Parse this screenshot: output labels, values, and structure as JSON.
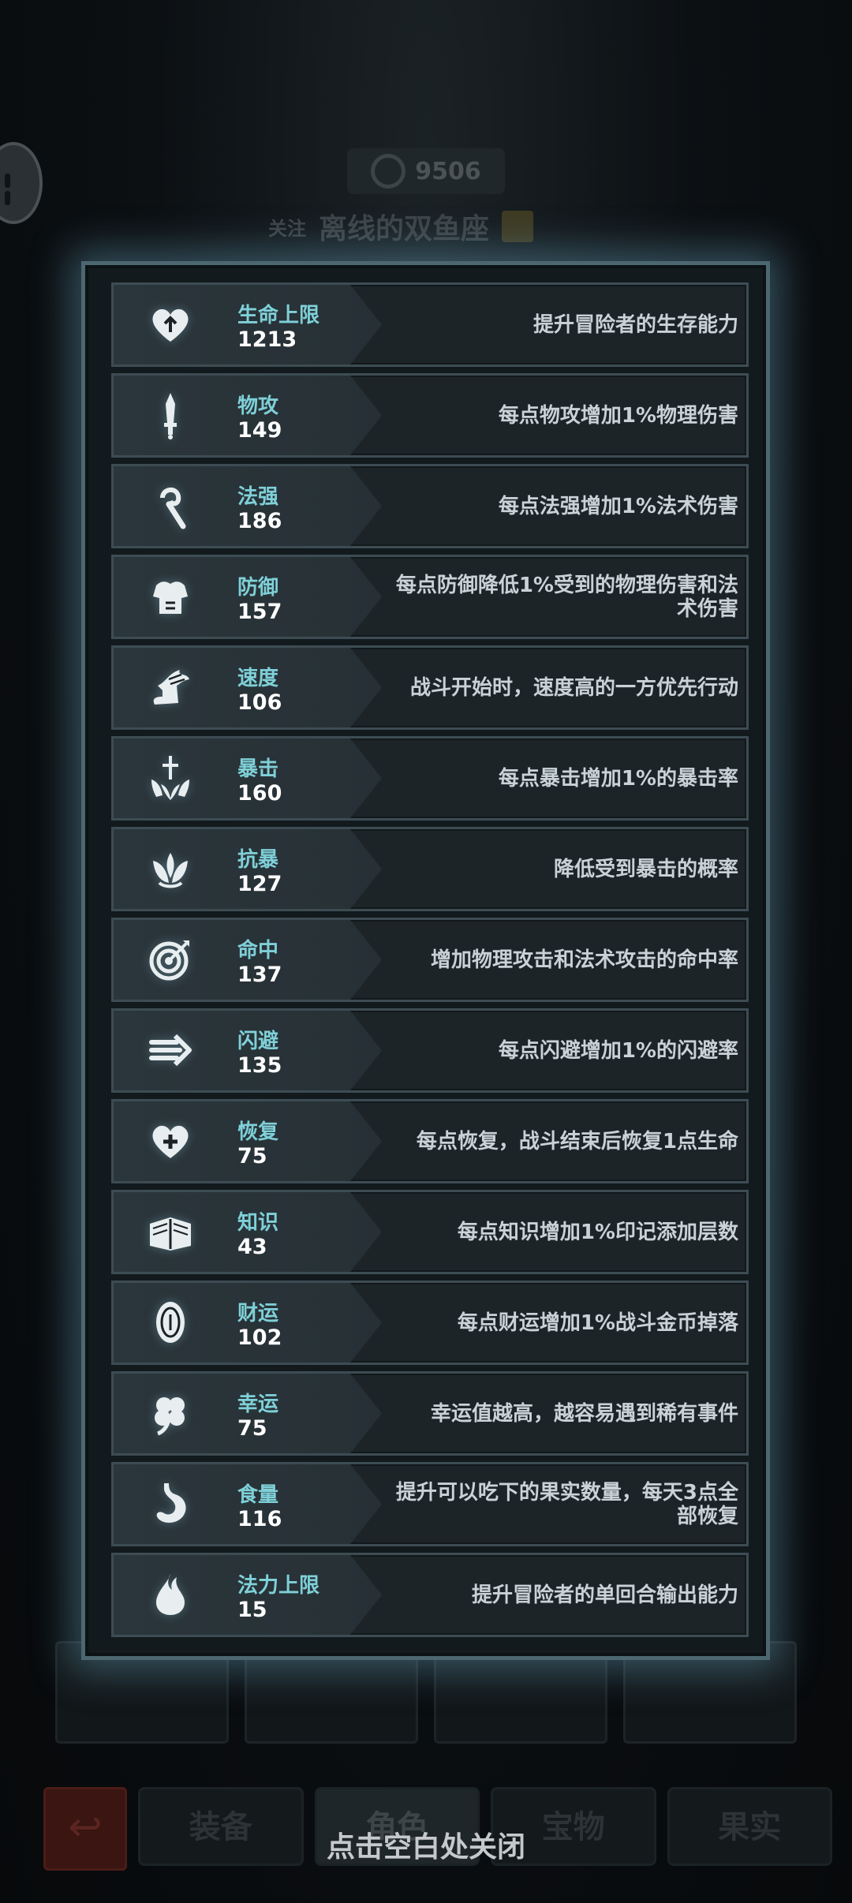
{
  "background": {
    "score": "9506",
    "follow_label": "关注",
    "player_name": "离线的双鱼座",
    "tabs": [
      "装备",
      "角色",
      "宝物",
      "果实"
    ]
  },
  "stats": [
    {
      "name": "生命上限",
      "value": "1213",
      "desc": "提升冒险者的生存能力",
      "icon": "heart-up-icon"
    },
    {
      "name": "物攻",
      "value": "149",
      "desc": "每点物攻增加1%物理伤害",
      "icon": "sword-icon"
    },
    {
      "name": "法强",
      "value": "186",
      "desc": "每点法强增加1%法术伤害",
      "icon": "staff-icon"
    },
    {
      "name": "防御",
      "value": "157",
      "desc": "每点防御降低1%受到的物理伤害和法术伤害",
      "icon": "armor-icon"
    },
    {
      "name": "速度",
      "value": "106",
      "desc": "战斗开始时，速度高的一方优先行动",
      "icon": "winged-boot-icon"
    },
    {
      "name": "暴击",
      "value": "160",
      "desc": "每点暴击增加1%的暴击率",
      "icon": "crit-burst-icon"
    },
    {
      "name": "抗暴",
      "value": "127",
      "desc": "降低受到暴击的概率",
      "icon": "crit-resist-icon"
    },
    {
      "name": "命中",
      "value": "137",
      "desc": "增加物理攻击和法术攻击的命中率",
      "icon": "target-icon"
    },
    {
      "name": "闪避",
      "value": "135",
      "desc": "每点闪避增加1%的闪避率",
      "icon": "dodge-arrows-icon"
    },
    {
      "name": "恢复",
      "value": "75",
      "desc": "每点恢复，战斗结束后恢复1点生命",
      "icon": "heart-plus-icon"
    },
    {
      "name": "知识",
      "value": "43",
      "desc": "每点知识增加1%印记添加层数",
      "icon": "book-icon"
    },
    {
      "name": "财运",
      "value": "102",
      "desc": "每点财运增加1%战斗金币掉落",
      "icon": "coin-icon"
    },
    {
      "name": "幸运",
      "value": "75",
      "desc": "幸运值越高，越容易遇到稀有事件",
      "icon": "clover-icon"
    },
    {
      "name": "食量",
      "value": "116",
      "desc": "提升可以吃下的果实数量，每天3点全部恢复",
      "icon": "stomach-icon"
    },
    {
      "name": "法力上限",
      "value": "15",
      "desc": "提升冒险者的单回合输出能力",
      "icon": "mana-drop-icon"
    }
  ],
  "close_hint": "点击空白处关闭",
  "colors": {
    "label": "#7fd0d8",
    "panel_border": "#4d6770",
    "glow": "#6eaac3"
  }
}
